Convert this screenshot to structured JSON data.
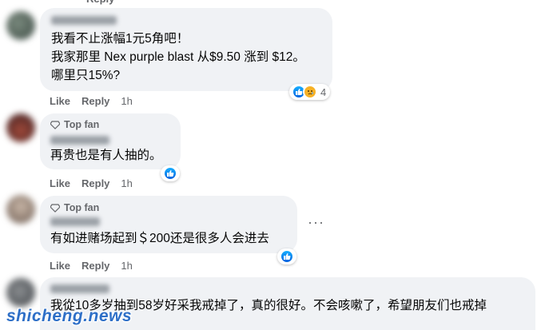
{
  "actions": {
    "like": "Like",
    "reply": "Reply",
    "time": "1h"
  },
  "top_fan_label": "Top fan",
  "comments": [
    {
      "lines": [
        "我看不止涨幅1元5角吧！",
        "我家那里 Nex purple blast 从$9.50 涨到 $12。",
        "哪里只15%?"
      ],
      "reaction_count": "4"
    },
    {
      "lines": [
        "再贵也是有人抽的。"
      ]
    },
    {
      "lines": [
        "有如进赌场起到＄200还是很多人会进去"
      ]
    },
    {
      "lines": [
        "我從10多岁抽到58岁好采我戒掉了，真的很好。不会咳嗽了，希望朋友们也戒掉"
      ]
    }
  ],
  "more_options_glyph": "···",
  "watermark": "shicheng.news",
  "colors": {
    "bubble": "#f0f2f5",
    "muted": "#65676b",
    "like_blue": "#1877f2",
    "watermark": "#2e6fc7"
  }
}
